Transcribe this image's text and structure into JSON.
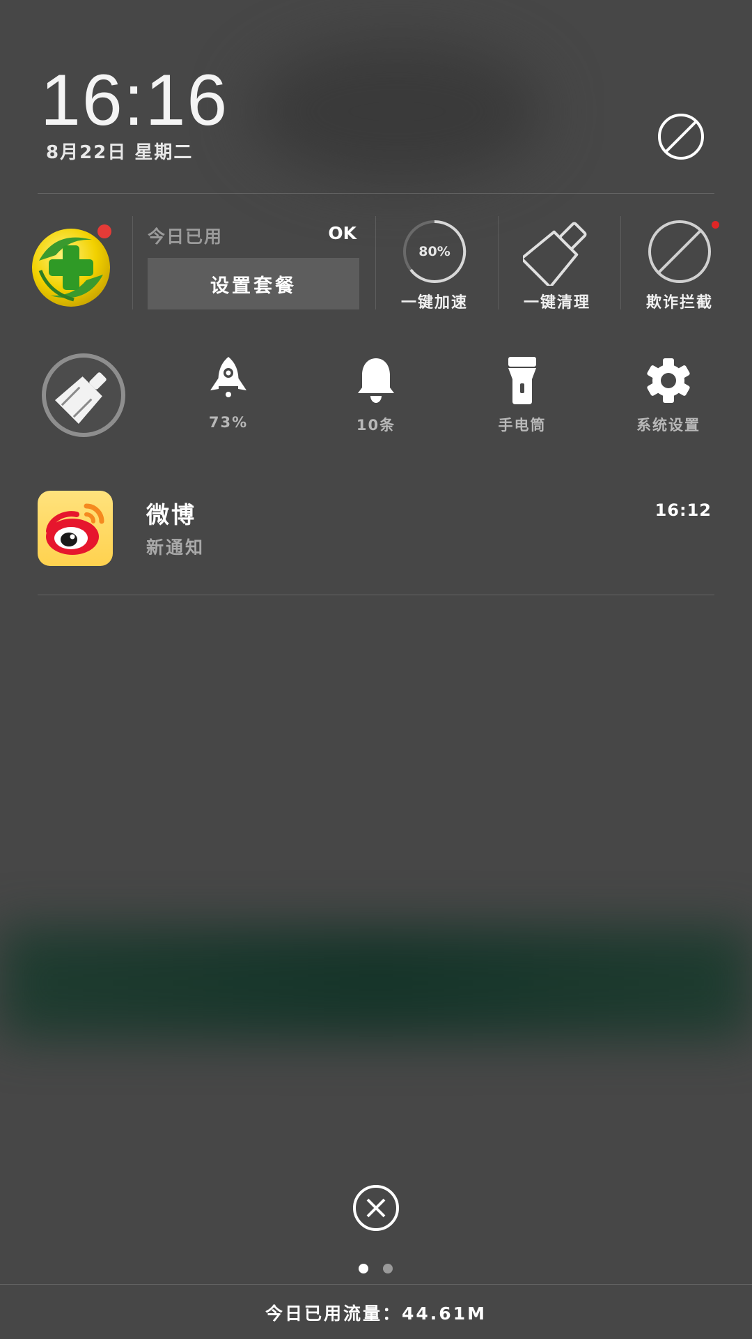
{
  "header": {
    "time": "16:16",
    "date": "8月22日 星期二",
    "block_icon": "block-icon"
  },
  "traffic_card": {
    "app_icon": "qihoo-360-logo",
    "used_label": "今日已用",
    "used_value": "OK",
    "plan_button": "设置套餐"
  },
  "tools": {
    "speedup": {
      "label": "一键加速",
      "value": "80%",
      "icon": "speed-ring-icon"
    },
    "clean": {
      "label": "一键清理",
      "icon": "broom-icon"
    },
    "fraud_block": {
      "label": "欺诈拦截",
      "icon": "block-icon"
    }
  },
  "toggles": [
    {
      "name": "clean-toggle",
      "icon": "broom-icon",
      "label": ""
    },
    {
      "name": "rocket",
      "icon": "rocket-icon",
      "label": "73%"
    },
    {
      "name": "notifications",
      "icon": "bell-icon",
      "label": "10条"
    },
    {
      "name": "flashlight",
      "icon": "flashlight-icon",
      "label": "手电筒"
    },
    {
      "name": "settings",
      "icon": "gear-icon",
      "label": "系统设置"
    }
  ],
  "notification": {
    "app_icon": "weibo-icon",
    "title": "微博",
    "text": "新通知",
    "time": "16:12"
  },
  "pager": {
    "pages": 2,
    "active_index": 0
  },
  "footer": {
    "text": "今日已用流量：44.61M"
  },
  "colors": {
    "background": "#474747",
    "accent_red": "#e53b37",
    "weibo_yellow": "#ffd24f",
    "weibo_red": "#e6162d"
  }
}
